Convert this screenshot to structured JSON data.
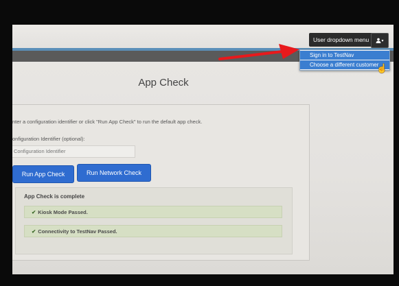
{
  "header": {
    "dropdown_label": "User dropdown menu",
    "user_icon": "user-icon",
    "caret_icon": "caret-down-icon"
  },
  "menu": {
    "items": [
      {
        "label": "Sign in to TestNav"
      },
      {
        "label": "Choose a different customer"
      }
    ]
  },
  "page": {
    "title": "App Check",
    "instructions": "nter a configuration identifier or click \"Run App Check\" to run the default app check.",
    "identifier_label": "onfiguration Identifier (optional):",
    "identifier_placeholder": "Configuration Identifier",
    "buttons": {
      "run_app_check": "Run App Check",
      "run_network_check": "Run Network Check"
    }
  },
  "results": {
    "title": "App Check is complete",
    "items": [
      {
        "text": "Kiosk Mode Passed."
      },
      {
        "text": "Connectivity to TestNav Passed."
      }
    ]
  },
  "annotation": {
    "arrow_color": "#e8191c",
    "accent": "#2f6cd0"
  }
}
